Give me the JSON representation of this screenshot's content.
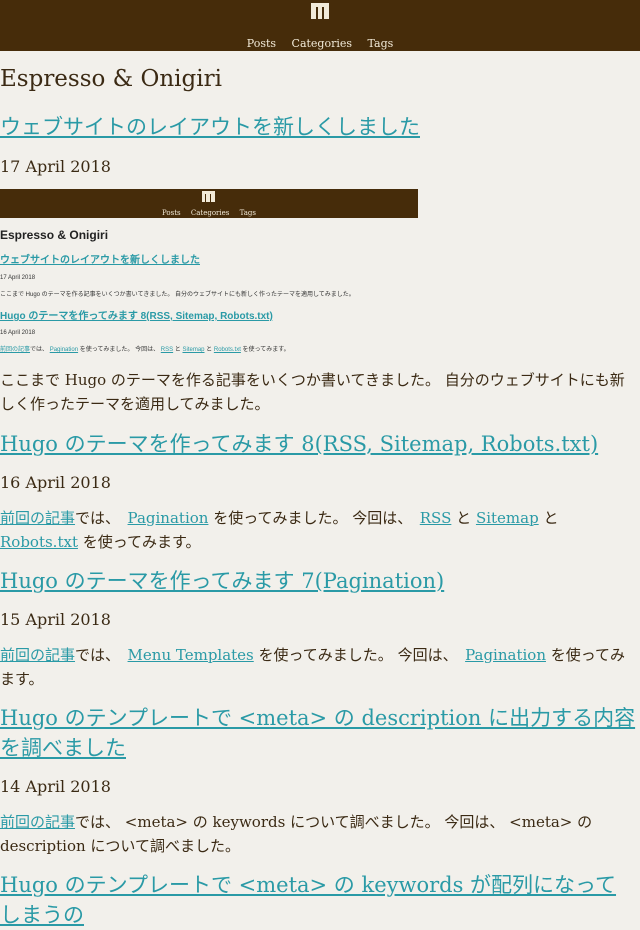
{
  "nav": {
    "items": [
      "Posts",
      "Categories",
      "Tags"
    ]
  },
  "site": {
    "title": "Espresso & Onigiri"
  },
  "posts": [
    {
      "title": "ウェブサイトのレイアウトを新しくしました",
      "date": "17 April 2018",
      "excerpt": "ここまで Hugo のテーマを作る記事をいくつか書いてきました。 自分のウェブサイトにも新しく作ったテーマを適用してみました。"
    },
    {
      "title": "Hugo のテーマを作ってみます 8(RSS, Sitemap, Robots.txt)",
      "date": "16 April 2018",
      "excerpt_parts": {
        "link1": "前回の記事",
        "t1": "では、",
        "link2": "Pagination",
        "t2": "を使ってみました。 今回は、",
        "link3": "RSS",
        "t3": "と",
        "link4": "Sitemap",
        "t4": "と",
        "link5": "Robots.txt",
        "t5": "を使ってみます。"
      }
    },
    {
      "title": "Hugo のテーマを作ってみます 7(Pagination)",
      "date": "15 April 2018",
      "excerpt_parts": {
        "link1": "前回の記事",
        "t1": "では、",
        "link2": "Menu Templates",
        "t2": "を使ってみました。 今回は、",
        "link3": "Pagination",
        "t3": "を使ってみます。"
      }
    },
    {
      "title": "Hugo のテンプレートで <meta> の description に出力する内容を調べました",
      "date": "14 April 2018",
      "excerpt_parts": {
        "link1": "前回の記事",
        "t1": "では、 <meta> の keywords について調べました。 今回は、 <meta> の description について調べました。"
      }
    },
    {
      "title": "Hugo のテンプレートで <meta> の keywords が配列になってしまうの"
    }
  ],
  "thumbnail": {
    "nav": [
      "Posts",
      "Categories",
      "Tags"
    ],
    "title": "Espresso & Onigiri",
    "post1_title": "ウェブサイトのレイアウトを新しくしました",
    "post1_date": "17 April 2018",
    "post1_text": "ここまで Hugo のテーマを作る記事をいくつか書いてきました。 自分のウェブサイトにも新しく作ったテーマを適用してみました。",
    "post2_title": "Hugo のテーマを作ってみます 8(RSS, Sitemap, Robots.txt)",
    "post2_date": "16 April 2018",
    "post2_link1": "前回の記事",
    "post2_t1": "では、",
    "post2_link2": "Pagination",
    "post2_t2": "を使ってみました。 今回は、",
    "post2_link3": "RSS",
    "post2_t3": "と",
    "post2_link4": "Sitemap",
    "post2_t4": "と",
    "post2_link5": "Robots.txt",
    "post2_t5": "を使ってみます。"
  },
  "colors": {
    "header": "#462c0a",
    "link": "#2a9aa6",
    "background": "#f2f0eb"
  }
}
